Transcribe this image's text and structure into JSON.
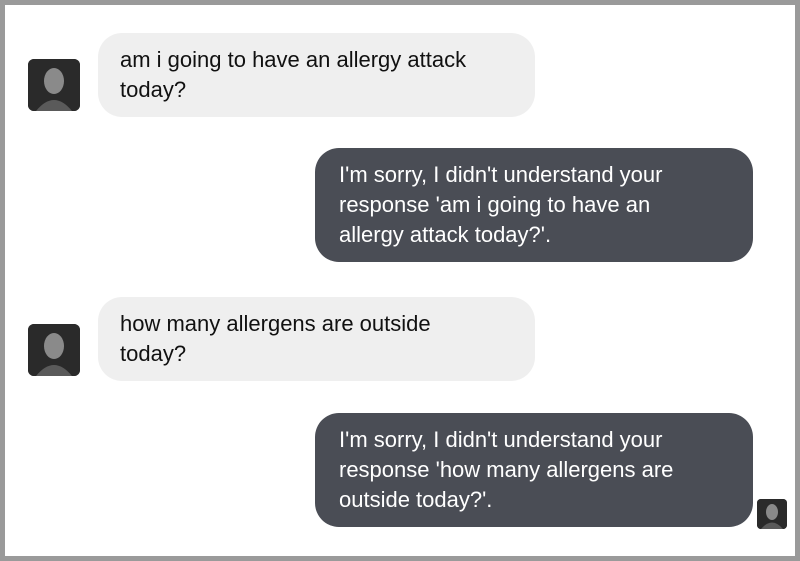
{
  "messages": [
    {
      "sender": "user",
      "lines": [
        "am i going to have an allergy attack",
        "today?"
      ]
    },
    {
      "sender": "bot",
      "lines": [
        "I'm sorry, I didn't understand your",
        "response 'am i going to have an",
        "allergy attack today?'."
      ]
    },
    {
      "sender": "user",
      "lines": [
        "how many allergens are outside",
        "today?"
      ]
    },
    {
      "sender": "bot",
      "lines": [
        "I'm sorry, I didn't understand your",
        "response 'how many allergens are",
        "outside today?'."
      ]
    }
  ],
  "icons": {
    "user_avatar": "user-avatar-photo",
    "bot_avatar": "bot-avatar-photo"
  },
  "colors": {
    "user_bubble": "#efefef",
    "bot_bubble": "#4a4d55",
    "bot_text": "#ffffff"
  }
}
